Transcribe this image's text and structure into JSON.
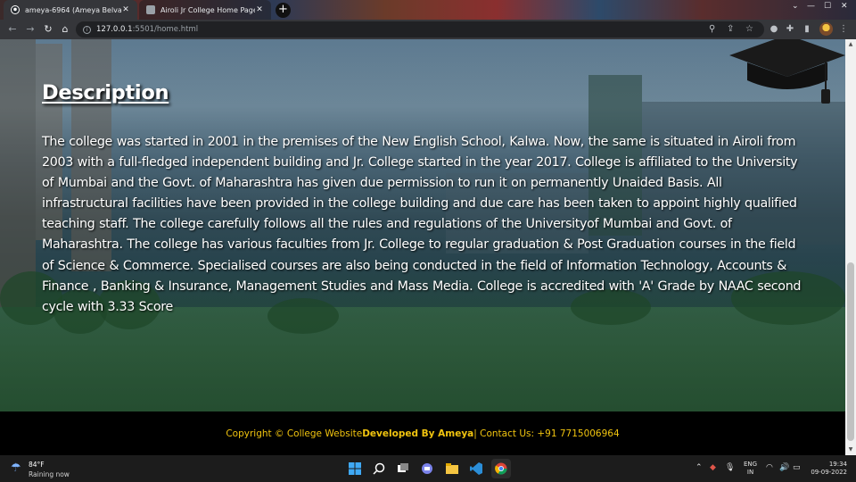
{
  "browser": {
    "tabs": [
      {
        "title": "ameya-6964 (Ameya Belvalkar)",
        "active": true
      },
      {
        "title": "Airoli Jr College Home Page",
        "active": false
      }
    ],
    "new_tab_label": "+",
    "url_host": "127.0.0.1",
    "url_path": ":5501/home.html"
  },
  "page": {
    "heading": "Description",
    "description": "The college was started in 2001 in the premises of the New English School, Kalwa. Now, the same is situated in Airoli from 2003 with a full-fledged independent building and Jr. College started in the year 2017. College is affiliated to the University of Mumbai and the Govt. of Maharashtra has given due permission to run it on permanently Unaided Basis. All infrastructural facilities have been provided in the college building and due care has been taken to appoint highly qualified teaching staff. The college carefully follows all the rules and regulations of the Universityof Mumbai and Govt. of Maharashtra. The college has various faculties from Jr. College to regular graduation & Post Graduation courses in the field of Science & Commerce. Specialised courses are also being conducted in the field of Information Technology, Accounts & Finance , Banking & Insurance, Management Studies and Mass Media. College is accredited with 'A' Grade by NAAC second cycle with 3.33 Score",
    "footer": {
      "prefix": "Copyright © College Website ",
      "developer": "Developed By Ameya",
      "suffix": " | Contact Us: +91 7715006964"
    }
  },
  "taskbar": {
    "weather_temp": "84°F",
    "weather_desc": "Raining now",
    "lang_line1": "ENG",
    "lang_line2": "IN",
    "time": "19:34",
    "date": "09-09-2022"
  },
  "colors": {
    "footer_text": "#f1c40f",
    "footer_bg": "#000000",
    "heading_text": "#ffffff"
  }
}
